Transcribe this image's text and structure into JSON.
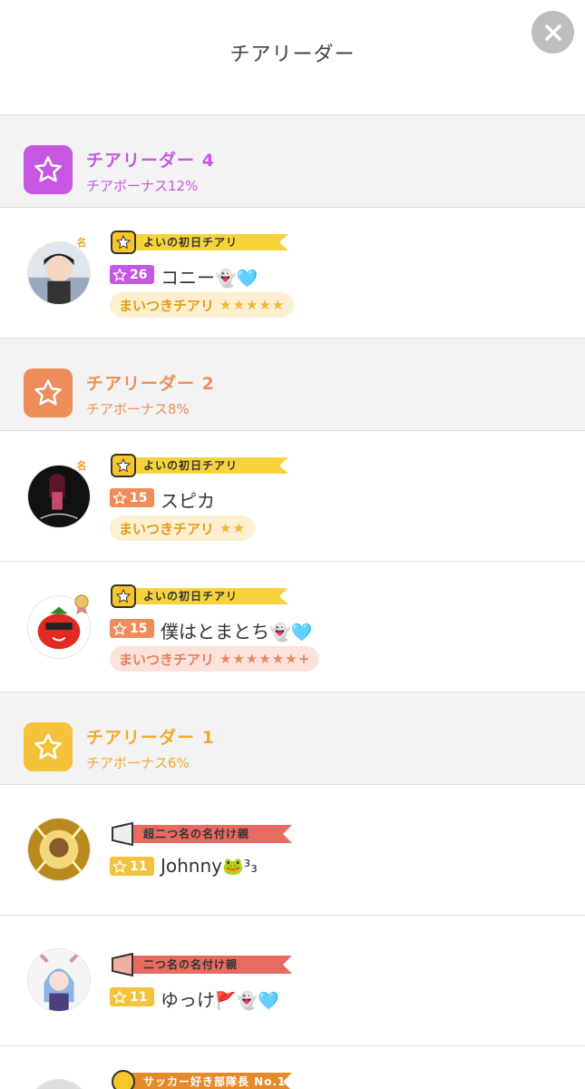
{
  "header": {
    "title": "チアリーダー",
    "close_icon": "close-x-icon"
  },
  "groups": [
    {
      "tier": "チアリーダー 4",
      "bonus": "チアボーナス12%",
      "color": "#c757e3"
    },
    {
      "tier": "チアリーダー 2",
      "bonus": "チアボーナス8%",
      "color": "#ee8d59"
    },
    {
      "tier": "チアリーダー 1",
      "bonus": "チアボーナス6%",
      "color": "#f5c23b"
    }
  ],
  "users": [
    {
      "level": "26",
      "level_color": "#c757e3",
      "name": "コニー",
      "emojis": "👻🩵",
      "title": "よいの初日チアリ",
      "daily_label": "まいつきチアリ",
      "daily_stars": "★★★★★",
      "badge": "名"
    },
    {
      "level": "15",
      "level_color": "#ee8d59",
      "name": "スピカ",
      "emojis": "",
      "title": "よいの初日チアリ",
      "daily_label": "まいつきチアリ",
      "daily_stars": "★★",
      "badge": "名"
    },
    {
      "level": "15",
      "level_color": "#ee8d59",
      "name": "僕はとまとち",
      "emojis": "👻🩵",
      "title": "よいの初日チアリ",
      "daily_label": "まいつきチアリ",
      "daily_stars": "★★★★★★+"
    },
    {
      "level": "11",
      "level_color": "#f5c23b",
      "name": "Johnny",
      "emojis": "🐸³₃",
      "title": "超二つ名の名付け親"
    },
    {
      "level": "11",
      "level_color": "#f5c23b",
      "name": "ゆっけ",
      "emojis": "🚩👻🩵",
      "title": "二つ名の名付け親"
    },
    {
      "title": "サッカー好き部隊長 No.1"
    }
  ]
}
